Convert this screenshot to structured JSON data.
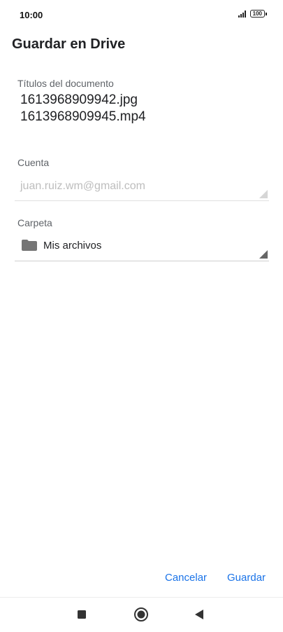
{
  "status_bar": {
    "time": "10:00",
    "battery": "100",
    "icons": [
      "signal-icon",
      "battery-icon"
    ]
  },
  "dialog": {
    "title": "Guardar en Drive",
    "documents_label": "Títulos del documento",
    "documents": [
      "1613968909942.jpg",
      "1613968909945.mp4"
    ],
    "account_label": "Cuenta",
    "account_value": "juan.ruiz.wm@gmail.com",
    "folder_label": "Carpeta",
    "folder_value": "Mis archivos",
    "folder_icon": "folder-icon",
    "cancel_label": "Cancelar",
    "save_label": "Guardar"
  },
  "colors": {
    "accent": "#1a73e8",
    "disabled_text": "#bdbdbd",
    "label_text": "#5f6368",
    "divider": "#e0e0e0"
  },
  "nav_bar": {
    "buttons": [
      "recents-icon",
      "home-icon",
      "back-icon"
    ]
  }
}
